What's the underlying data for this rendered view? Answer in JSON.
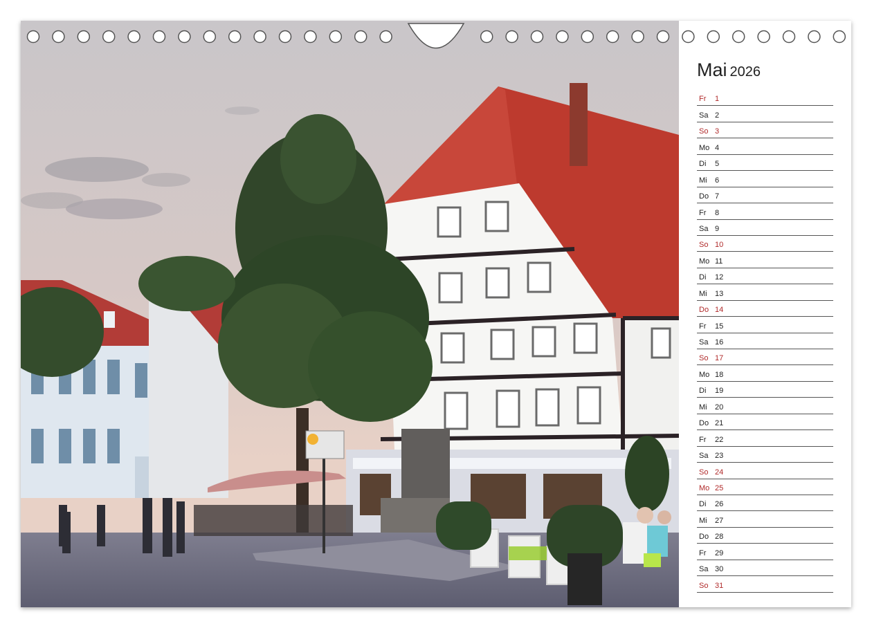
{
  "calendar": {
    "month": "Mai",
    "year": "2026",
    "days": [
      {
        "wd": "Fr",
        "d": "1",
        "red": true
      },
      {
        "wd": "Sa",
        "d": "2",
        "red": false
      },
      {
        "wd": "So",
        "d": "3",
        "red": true
      },
      {
        "wd": "Mo",
        "d": "4",
        "red": false
      },
      {
        "wd": "Di",
        "d": "5",
        "red": false
      },
      {
        "wd": "Mi",
        "d": "6",
        "red": false
      },
      {
        "wd": "Do",
        "d": "7",
        "red": false
      },
      {
        "wd": "Fr",
        "d": "8",
        "red": false
      },
      {
        "wd": "Sa",
        "d": "9",
        "red": false
      },
      {
        "wd": "So",
        "d": "10",
        "red": true
      },
      {
        "wd": "Mo",
        "d": "11",
        "red": false
      },
      {
        "wd": "Di",
        "d": "12",
        "red": false
      },
      {
        "wd": "Mi",
        "d": "13",
        "red": false
      },
      {
        "wd": "Do",
        "d": "14",
        "red": true
      },
      {
        "wd": "Fr",
        "d": "15",
        "red": false
      },
      {
        "wd": "Sa",
        "d": "16",
        "red": false
      },
      {
        "wd": "So",
        "d": "17",
        "red": true
      },
      {
        "wd": "Mo",
        "d": "18",
        "red": false
      },
      {
        "wd": "Di",
        "d": "19",
        "red": false
      },
      {
        "wd": "Mi",
        "d": "20",
        "red": false
      },
      {
        "wd": "Do",
        "d": "21",
        "red": false
      },
      {
        "wd": "Fr",
        "d": "22",
        "red": false
      },
      {
        "wd": "Sa",
        "d": "23",
        "red": false
      },
      {
        "wd": "So",
        "d": "24",
        "red": true
      },
      {
        "wd": "Mo",
        "d": "25",
        "red": true
      },
      {
        "wd": "Di",
        "d": "26",
        "red": false
      },
      {
        "wd": "Mi",
        "d": "27",
        "red": false
      },
      {
        "wd": "Do",
        "d": "28",
        "red": false
      },
      {
        "wd": "Fr",
        "d": "29",
        "red": false
      },
      {
        "wd": "Sa",
        "d": "30",
        "red": false
      },
      {
        "wd": "So",
        "d": "31",
        "red": true
      }
    ]
  },
  "colors": {
    "holiday": "#b02a2a",
    "roof": "#b8322a",
    "sky": "#d9cfcc"
  },
  "photo": {
    "icon": "old-town-square-photo"
  }
}
